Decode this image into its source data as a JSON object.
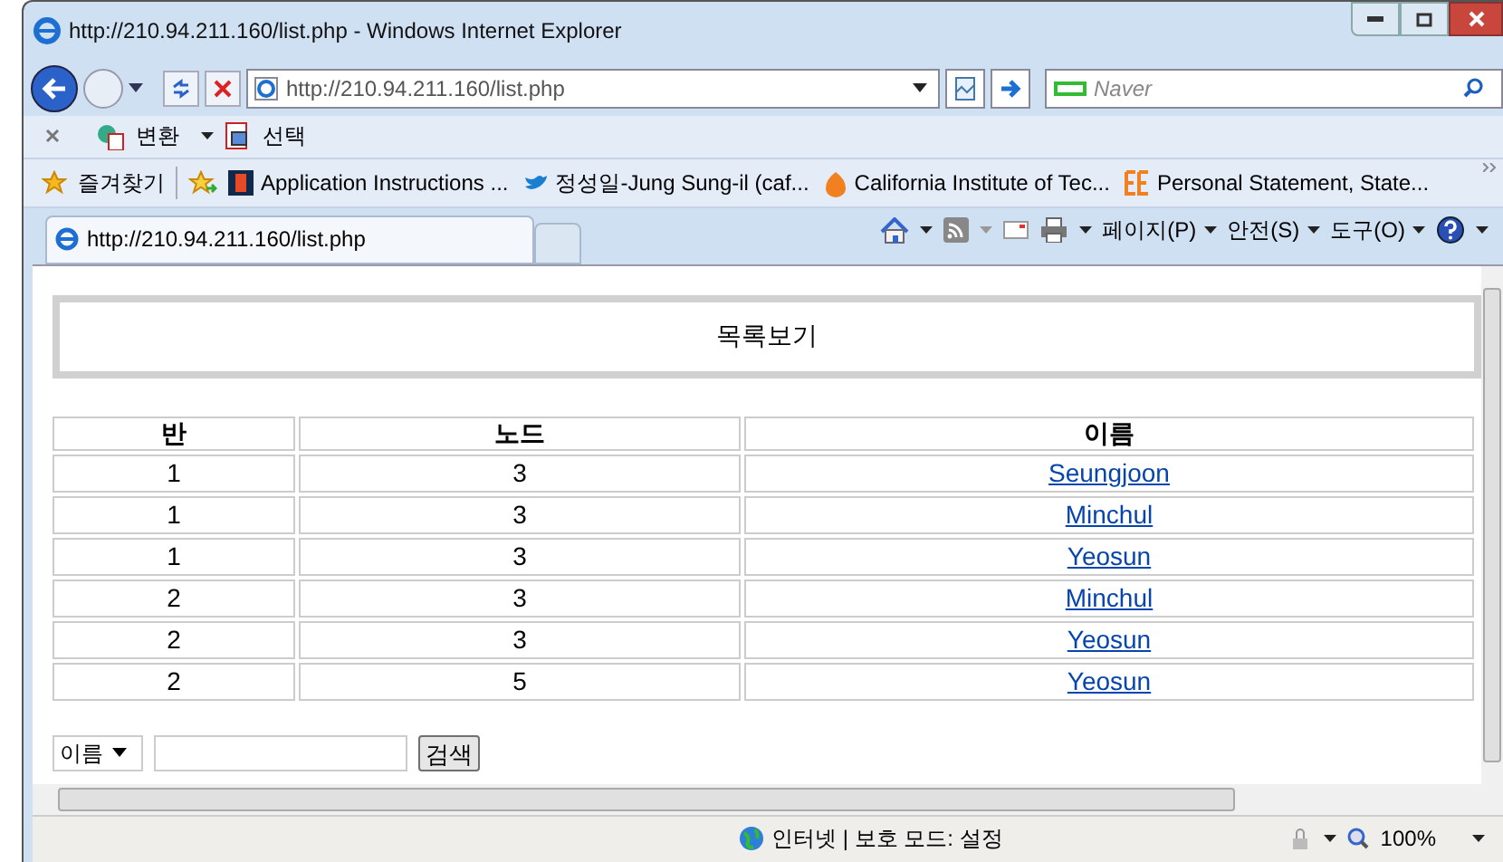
{
  "window": {
    "title": "http://210.94.211.160/list.php - Windows Internet Explorer"
  },
  "address_bar": {
    "url": "http://210.94.211.160/list.php"
  },
  "search_box": {
    "placeholder": "Naver"
  },
  "command_bar": {
    "items": [
      "변환",
      "선택"
    ]
  },
  "favorites_bar": {
    "label": "즐겨찾기",
    "links": [
      "Application Instructions ...",
      "정성일-Jung Sung-il (caf...",
      "California Institute of Tec...",
      "Personal Statement, State..."
    ]
  },
  "tabs": [
    {
      "label": "http://210.94.211.160/list.php",
      "selected": true
    }
  ],
  "tool_menu": [
    "페이지(P)",
    "안전(S)",
    "도구(O)"
  ],
  "page": {
    "heading": "목록보기",
    "table": {
      "columns": [
        "반",
        "노드",
        "이름"
      ],
      "rows": [
        [
          "1",
          "3",
          "Seungjoon"
        ],
        [
          "1",
          "3",
          "Minchul"
        ],
        [
          "1",
          "3",
          "Yeosun"
        ],
        [
          "2",
          "3",
          "Minchul"
        ],
        [
          "2",
          "3",
          "Yeosun"
        ],
        [
          "2",
          "5",
          "Yeosun"
        ]
      ]
    },
    "search_form": {
      "field_select": "이름",
      "button": "검색"
    }
  },
  "status_bar": {
    "zone": "인터넷 | 보호 모드: 설정",
    "zoom": "100%"
  }
}
